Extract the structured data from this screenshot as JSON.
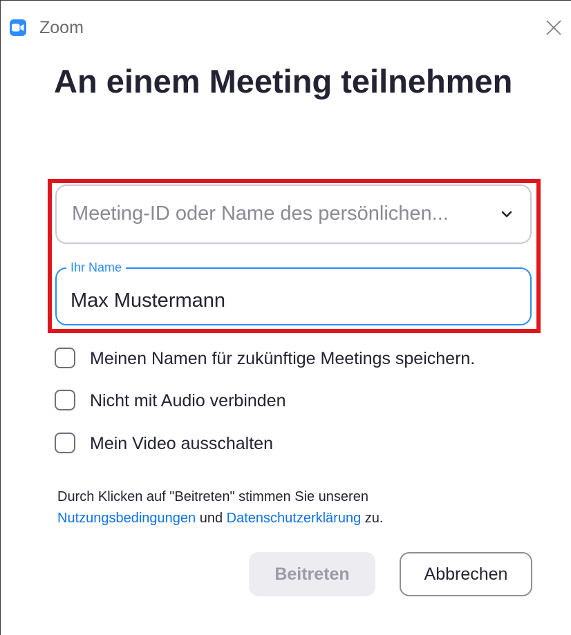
{
  "window": {
    "app_title": "Zoom",
    "close_icon": "close-icon"
  },
  "dialog": {
    "heading": "An einem Meeting teilnehmen",
    "meeting_id": {
      "placeholder": "Meeting-ID oder Name des persönlichen...",
      "value": "",
      "icon": "chevron-down-icon"
    },
    "name": {
      "legend": "Ihr Name",
      "value": "Max Mustermann"
    },
    "options": [
      {
        "label": "Meinen Namen für zukünftige Meetings speichern.",
        "checked": false
      },
      {
        "label": "Nicht mit Audio verbinden",
        "checked": false
      },
      {
        "label": "Mein Video ausschalten",
        "checked": false
      }
    ],
    "terms": {
      "line1": "Durch Klicken auf \"Beitreten\" stimmen Sie unseren",
      "terms_link": "Nutzungsbedingungen",
      "conjunction": " und ",
      "privacy_link": "Datenschutzerklärung",
      "suffix": " zu."
    },
    "buttons": {
      "join_label": "Beitreten",
      "cancel_label": "Abbrechen"
    }
  },
  "colors": {
    "accent": "#2d8cff",
    "link": "#0e71eb",
    "highlight": "#e0161c",
    "text": "#232333"
  }
}
